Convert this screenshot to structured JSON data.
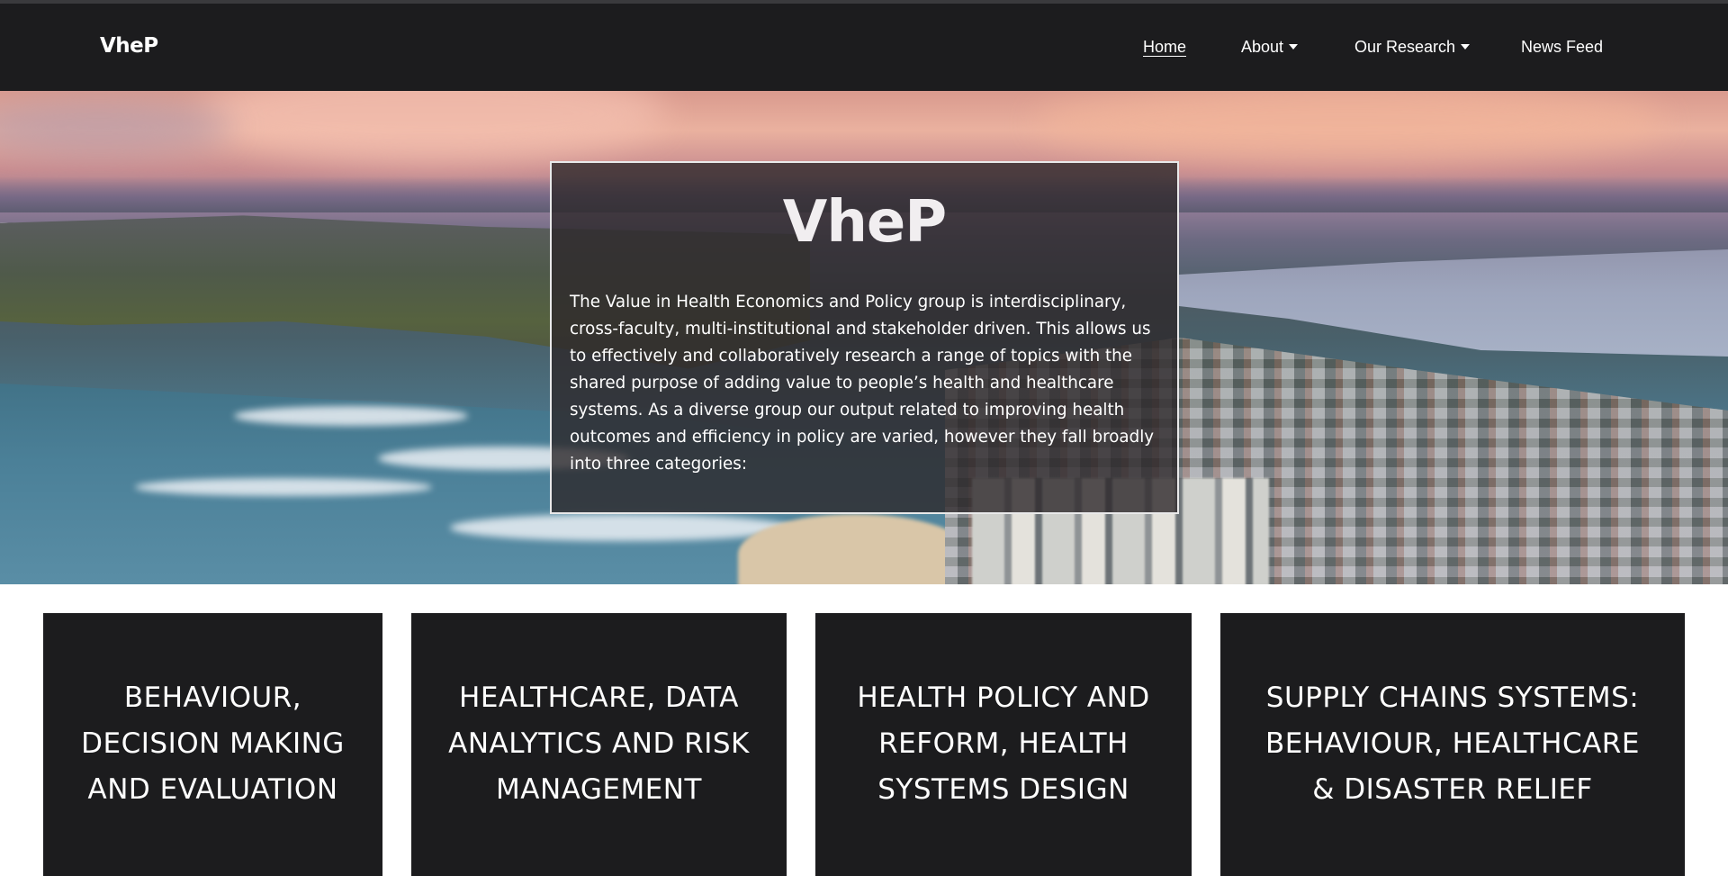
{
  "nav": {
    "brand": "VheP",
    "items": [
      {
        "label": "Home",
        "active": true,
        "dropdown": false
      },
      {
        "label": "About",
        "active": false,
        "dropdown": true
      },
      {
        "label": "Our Research",
        "active": false,
        "dropdown": true
      },
      {
        "label": "News Feed",
        "active": false,
        "dropdown": false
      }
    ]
  },
  "hero": {
    "title": "VheP",
    "description": "The Value in Health Economics and Policy group is interdisciplinary, cross-faculty, multi-institutional and stakeholder driven. This allows us to effectively and collaboratively research a range of topics with the shared purpose of adding value to people’s health and healthcare systems. As a diverse group our output related to improving health outcomes and efficiency in policy are varied, however they fall broadly into three categories:"
  },
  "research_cards": [
    {
      "title": "BEHAVIOUR,\nDECISION MAKING\nAND EVALUATION"
    },
    {
      "title": "HEALTHCARE, DATA\nANALYTICS AND RISK\nMANAGEMENT"
    },
    {
      "title": "HEALTH POLICY AND\nREFORM, HEALTH\nSYSTEMS DESIGN"
    },
    {
      "title": "SUPPLY CHAINS SYSTEMS:\nBEHAVIOUR, HEALTHCARE\n& DISASTER RELIEF"
    }
  ],
  "colors": {
    "nav_background": "#1c1c1e",
    "card_background": "#1c1c1e",
    "overlay_background": "rgba(45,40,42,0.80)",
    "text": "#ffffff"
  }
}
